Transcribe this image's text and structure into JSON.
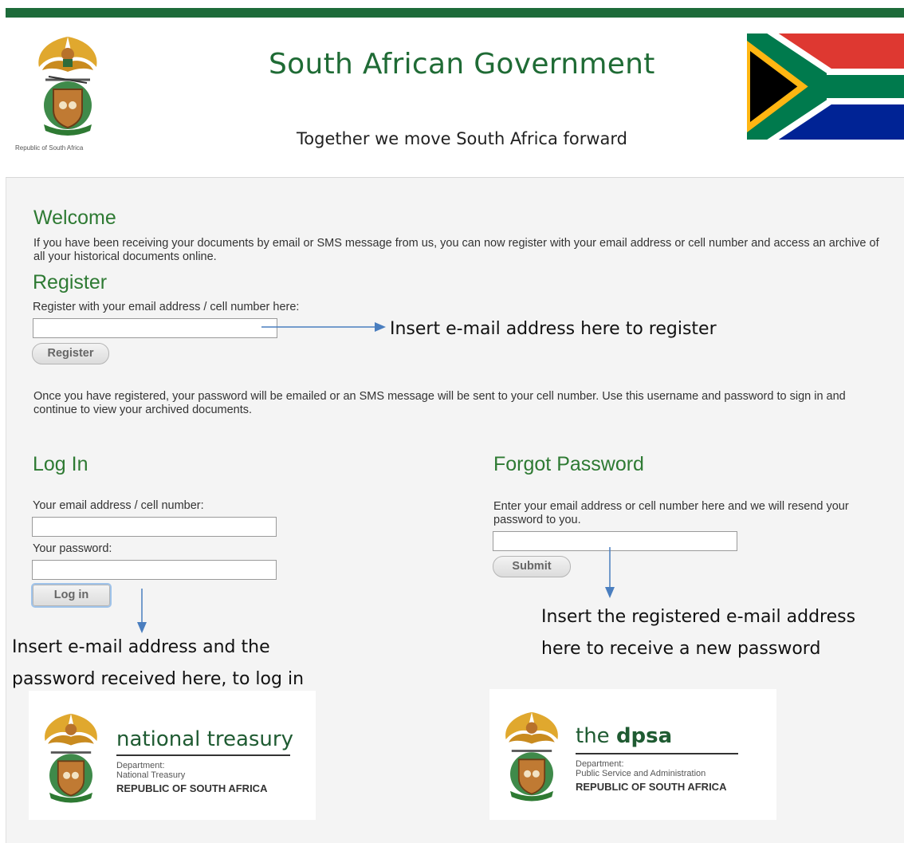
{
  "header": {
    "coat_caption": "Republic of South Africa",
    "title": "South African Government",
    "tagline": "Together we move South Africa forward"
  },
  "welcome": {
    "heading": "Welcome",
    "text": "If you have been receiving your documents by email or SMS message from us, you can now register with your email address or cell number and access an archive of all your historical documents online."
  },
  "register": {
    "heading": "Register",
    "label": "Register with your email address / cell number here:",
    "input_value": "",
    "button_label": "Register",
    "note": "Once you have registered, your password will be emailed or an SMS message will be sent to your cell number. Use this username and password to sign in and continue to view your archived documents."
  },
  "login": {
    "heading": "Log In",
    "email_label": "Your email address / cell number:",
    "email_value": "",
    "password_label": "Your password:",
    "password_value": "",
    "button_label": "Log in"
  },
  "forgot": {
    "heading": "Forgot Password",
    "text": "Enter your email address or cell number here and we will resend your password to you.",
    "input_value": "",
    "button_label": "Submit"
  },
  "annotations": {
    "register": "Insert e-mail address here to register",
    "login_line1": "Insert e-mail address and the",
    "login_line2": "password received here, to log in",
    "forgot_line1": "Insert the registered e-mail address",
    "forgot_line2": "here to receive a new password"
  },
  "logos": {
    "treasury": {
      "name": "national treasury",
      "dept_line1": "Department:",
      "dept_line2": "National Treasury",
      "country": "REPUBLIC OF SOUTH AFRICA"
    },
    "dpsa": {
      "name_prefix": "the ",
      "name_bold": "dpsa",
      "dept_line1": "Department:",
      "dept_line2": "Public Service and Administration",
      "country": "REPUBLIC OF SOUTH AFRICA"
    }
  },
  "colors": {
    "brand_green": "#1d6b3a",
    "heading_green": "#2e7a33",
    "arrow_blue": "#4a7ebf"
  },
  "icons": {
    "coat_of_arms": "coat-of-arms-icon",
    "flag": "south-africa-flag-icon",
    "arrow": "arrow-icon"
  }
}
